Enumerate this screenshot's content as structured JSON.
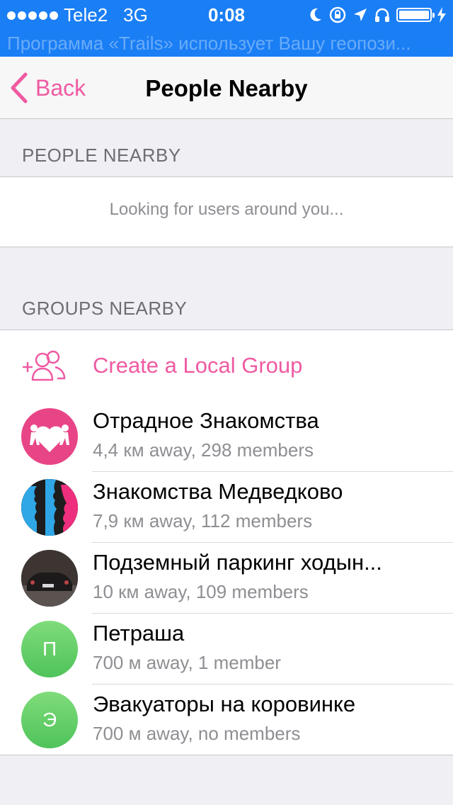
{
  "status_bar": {
    "carrier": "Tele2",
    "network": "3G",
    "time": "0:08",
    "banner": "Программа «Trails» использует Вашу геопози..."
  },
  "nav": {
    "back_label": "Back",
    "title": "People Nearby"
  },
  "people_section": {
    "header": "PEOPLE NEARBY",
    "status": "Looking for users around you..."
  },
  "groups_section": {
    "header": "GROUPS NEARBY",
    "create_label": "Create a Local Group",
    "groups": [
      {
        "name": "Отрадное Знакомства",
        "details": "4,4 км away, 298 members",
        "avatar": "hearts-couple-image"
      },
      {
        "name": "Знакомства Медведково",
        "details": "7,9 км away, 112 members",
        "avatar": "profiles-image"
      },
      {
        "name": "Подземный паркинг ходын...",
        "details": "10 км away, 109 members",
        "avatar": "car-photo"
      },
      {
        "name": "Петраша",
        "details": "700 м away, 1 member",
        "avatar_letter": "П"
      },
      {
        "name": "Эвакуаторы на коровинке",
        "details": "700 м away, no members",
        "avatar_letter": "Э"
      }
    ]
  },
  "colors": {
    "accent": "#ef5aa2",
    "status_bar_bg": "#1a7ef5",
    "letter_avatar": "#4fc35a"
  }
}
